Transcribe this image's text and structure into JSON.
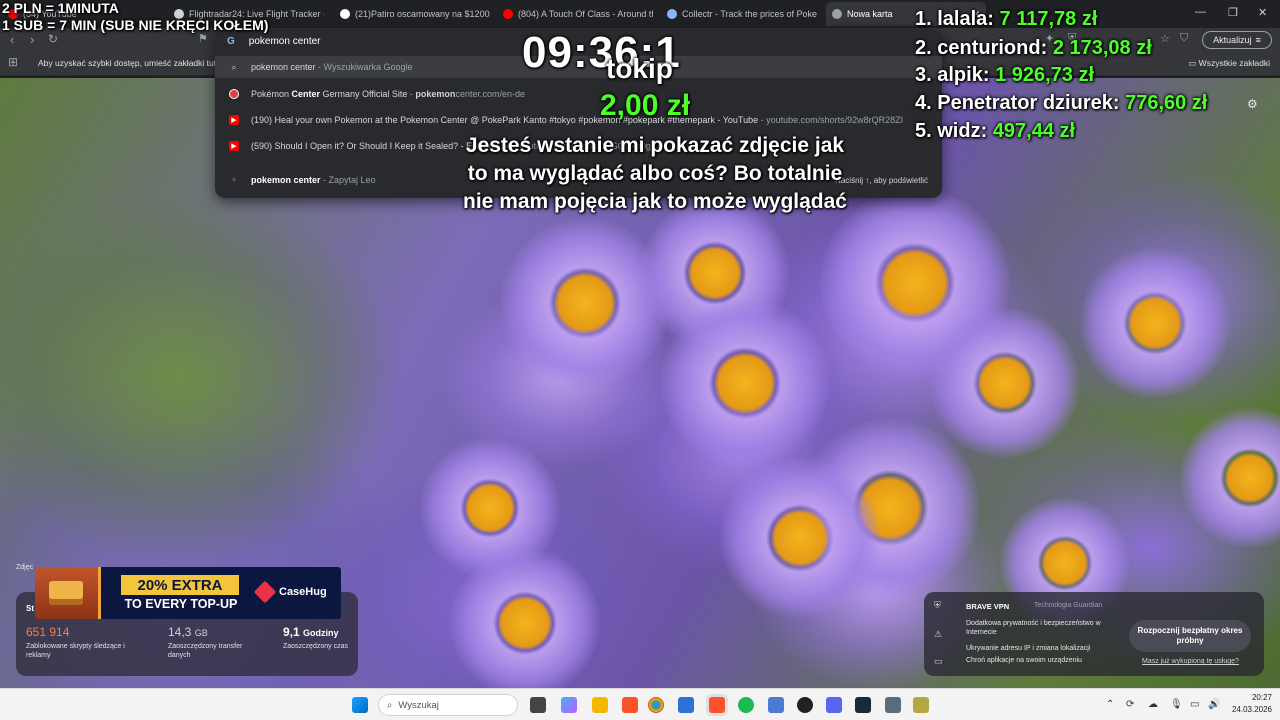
{
  "browser": {
    "tabs": [
      {
        "label": "(64) YouTube",
        "color": "#ff0000"
      },
      {
        "label": "Flightradar24: Live Flight Tracker - Re",
        "color": "#cfd2d6"
      },
      {
        "label": "(21)Patiro oscamowany na $1200 #p",
        "color": "#ffffff"
      },
      {
        "label": "(804) A Touch Of Class - Around the",
        "color": "#ff0000"
      },
      {
        "label": "Collectr - Track the prices of Pokemo",
        "color": "#8ab4f8"
      },
      {
        "label": "Nowa karta",
        "color": "#9aa0a6"
      }
    ],
    "bookmarks_hint": "Aby uzyskać szybki dostęp, umieść zakładki tutaj n",
    "all_bookmarks": "Wszystkie zakładki",
    "update_button": "Aktualizuj"
  },
  "omnibox": {
    "query": "pokemon center",
    "suggestions": [
      {
        "title": "pokemon center",
        "suffix": " - Wyszukiwarka Google",
        "url": ""
      },
      {
        "title_pre": "Pokémon ",
        "title_bold": "Center",
        "title_post": " Germany Official Site",
        "url_bold": "pokemon",
        "url_rest": "center.com/en-de"
      },
      {
        "text": "(190) Heal your own Pokemon at the Pokemon Center @ PokePark Kanto #tokyo #pokemon #pokepark #themepark - YouTube",
        "url": "youtube.com/shorts/92w8rQR28ZI"
      },
      {
        "text": "(590) Should I Open it? Or Should I Keep it Sealed? - Episode 34",
        "url": "youtube.com/shorts/JVGO8Pn0gIU"
      },
      {
        "title": "pokemon center",
        "suffix": " - Zapytaj Leo",
        "hint": "Naciśnij ↑, aby podświetlić"
      }
    ]
  },
  "overlay": {
    "rule1": "2 PLN = 1MINUTA",
    "rule2": "1 SUB = 7 MIN (SUB NIE KRĘCI KOŁEM)",
    "timer": "09:36:1",
    "name": "tokip",
    "amount": "2,00 zł",
    "question": "Jesteś wstanie mi pokazać zdjęcie jak to ma wyglądać albo coś? Bo totalnie nie mam pojęcia jak to może wyglądać"
  },
  "leaderboard": [
    {
      "rank": "1.",
      "name": "lalala:",
      "amount": "7 117,78 zł"
    },
    {
      "rank": "2.",
      "name": "centuriond:",
      "amount": "2 173,08 zł"
    },
    {
      "rank": "3.",
      "name": "alpik:",
      "amount": "1 926,73 zł"
    },
    {
      "rank": "4.",
      "name": "Penetrator dziurek:",
      "amount": "776,60 zł"
    },
    {
      "rank": "5.",
      "name": "widz:",
      "amount": "497,44 zł"
    }
  ],
  "ad": {
    "extra": "20% EXTRA",
    "topup": "TO EVERY TOP-UP",
    "brand": "CaseHug"
  },
  "stats": {
    "credit": "Zdjęc",
    "heading": "St",
    "items": [
      {
        "value": "651 914",
        "unit": "",
        "desc": "Zablokowane skrypty śledzące i reklamy"
      },
      {
        "value": "14,3",
        "unit": "GB",
        "desc": "Zaoszczędzony transfer danych"
      },
      {
        "value": "9,1",
        "unit": "Godziny",
        "desc": "Zaoszczędzony czas"
      }
    ]
  },
  "vpn": {
    "title": "BRAVE VPN",
    "tech": "Technologia Guardian",
    "features": [
      "Dodatkowa prywatność i bezpieczeństwo w Internecie",
      "Ukrywanie adresu IP i zmiana lokalizacji",
      "Chroń aplikacje na swoim urządzeniu"
    ],
    "button": "Rozpocznij bezpłatny okres próbny",
    "link": "Masz już wykupioną tę usługę?"
  },
  "taskbar": {
    "search": "Wyszukaj",
    "time": "20:27",
    "date": "24.03.2026"
  }
}
